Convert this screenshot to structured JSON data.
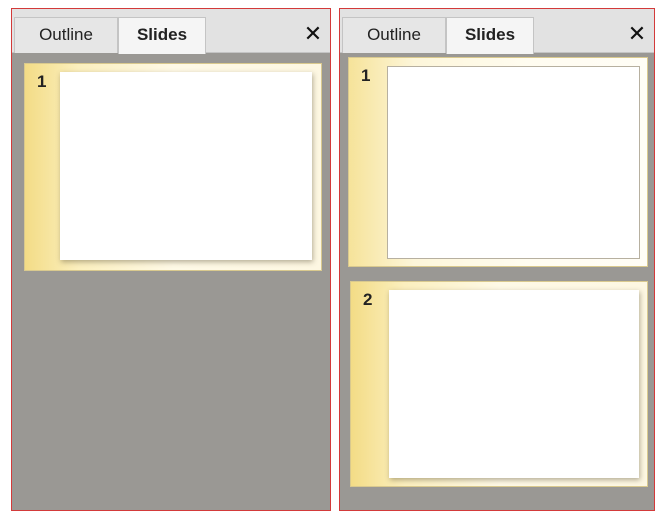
{
  "panels": [
    {
      "tabs": {
        "outline": "Outline",
        "slides": "Slides"
      },
      "close": "✕",
      "slides": [
        {
          "number": "1"
        }
      ]
    },
    {
      "tabs": {
        "outline": "Outline",
        "slides": "Slides"
      },
      "close": "✕",
      "slides": [
        {
          "number": "1"
        },
        {
          "number": "2"
        }
      ]
    }
  ]
}
